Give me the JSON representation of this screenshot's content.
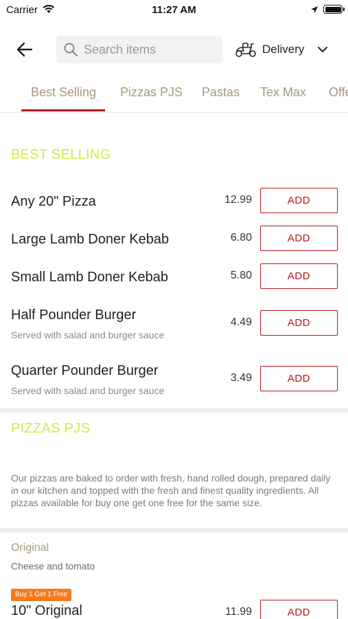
{
  "status_bar": {
    "carrier": "Carrier",
    "time": "11:27 AM"
  },
  "header": {
    "search_placeholder": "Search items",
    "delivery_label": "Delivery"
  },
  "tabs": [
    {
      "label": "Best Selling"
    },
    {
      "label": "Pizzas PJS"
    },
    {
      "label": "Pastas"
    },
    {
      "label": "Tex Max"
    },
    {
      "label": "Offers"
    }
  ],
  "best_selling": {
    "title": "BEST SELLING",
    "items": [
      {
        "name": "Any 20\" Pizza",
        "price": "12.99",
        "add": "ADD"
      },
      {
        "name": "Large Lamb Doner Kebab",
        "price": "6.80",
        "add": "ADD"
      },
      {
        "name": "Small Lamb Doner Kebab",
        "price": "5.80",
        "add": "ADD"
      },
      {
        "name": "Half Pounder Burger",
        "subtitle": "Served with salad and burger sauce",
        "price": "4.49",
        "add": "ADD"
      },
      {
        "name": "Quarter Pounder Burger",
        "subtitle": "Served with salad and burger sauce",
        "price": "3.49",
        "add": "ADD"
      }
    ]
  },
  "pizzas": {
    "title": "PIZZAS PJS",
    "description": "Our pizzas are baked to order with fresh, hand rolled dough, prepared daily in our kitchen and topped with the fresh and finest quality ingredients. All pizzas available for buy one get one free for the same size.",
    "group_label": "Original",
    "group_subtitle": "Cheese and tomato",
    "badge": "Buy 1 Get 1 Free",
    "item": {
      "name": "10\" Original",
      "price": "11.99",
      "add": "ADD"
    }
  },
  "colors": {
    "accent": "#b8141c",
    "section_title": "#d5e84d",
    "tab_text": "#a49a78",
    "badge": "#f47a20"
  }
}
